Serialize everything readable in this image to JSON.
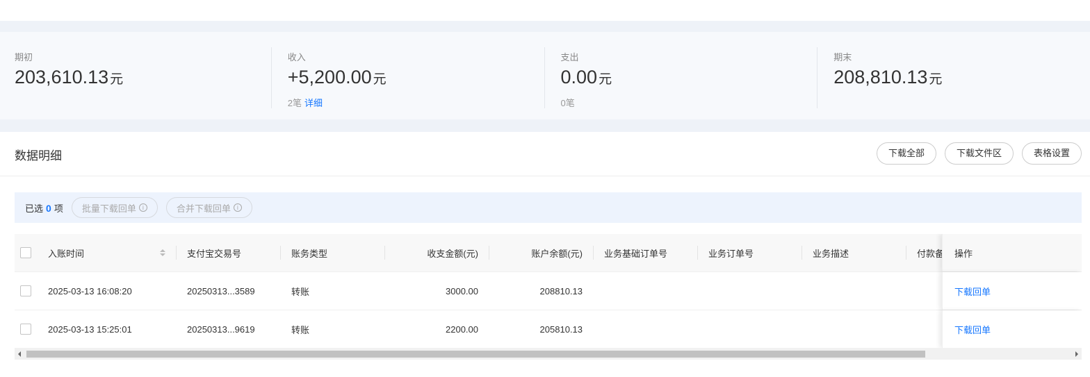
{
  "summary": {
    "opening": {
      "label": "期初",
      "amount": "203,610.13",
      "unit": "元"
    },
    "income": {
      "label": "收入",
      "amount": "+5,200.00",
      "unit": "元",
      "count": "2笔",
      "detail_link": "详细"
    },
    "expense": {
      "label": "支出",
      "amount": "0.00",
      "unit": "元",
      "count": "0笔"
    },
    "closing": {
      "label": "期末",
      "amount": "208,810.13",
      "unit": "元"
    }
  },
  "panel": {
    "title": "数据明细",
    "buttons": {
      "download_all": "下载全部",
      "download_area": "下载文件区",
      "table_settings": "表格设置"
    }
  },
  "selection": {
    "prefix": "已选",
    "count": "0",
    "suffix": "项",
    "batch_download": "批量下载回单",
    "merge_download": "合并下载回单"
  },
  "table": {
    "headers": {
      "time": "入账时间",
      "trade_no": "支付宝交易号",
      "type": "账务类型",
      "amount": "收支金额(元)",
      "balance": "账户余额(元)",
      "base_order": "业务基础订单号",
      "order": "业务订单号",
      "desc": "业务描述",
      "remark": "付款备注",
      "op": "操作"
    },
    "rows": [
      {
        "time": "2025-03-13 16:08:20",
        "trade_no": "20250313...3589",
        "type": "转账",
        "amount": "3000.00",
        "balance": "208810.13",
        "op": "下载回单"
      },
      {
        "time": "2025-03-13 15:25:01",
        "trade_no": "20250313...9619",
        "type": "转账",
        "amount": "2200.00",
        "balance": "205810.13",
        "op": "下载回单"
      }
    ]
  },
  "colors": {
    "accent": "#1677ff",
    "band": "#eef2f8",
    "select_bar": "#edf3fd"
  },
  "icons": {
    "sort": "sort-icon",
    "info": "info-icon",
    "checkbox": "checkbox-icon"
  }
}
